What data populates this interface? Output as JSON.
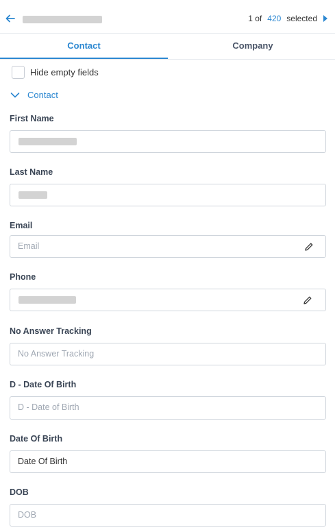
{
  "header": {
    "pager_prefix": "1 of",
    "pager_count": "420",
    "pager_suffix": "selected"
  },
  "tabs": [
    {
      "label": "Contact",
      "active": true
    },
    {
      "label": "Company",
      "active": false
    }
  ],
  "hide_empty_label": "Hide empty fields",
  "section": {
    "label": "Contact",
    "expanded": true
  },
  "fields": {
    "first_name": {
      "label": "First Name"
    },
    "last_name": {
      "label": "Last Name"
    },
    "email": {
      "label": "Email",
      "placeholder": "Email"
    },
    "phone": {
      "label": "Phone"
    },
    "no_answer": {
      "label": "No Answer Tracking",
      "placeholder": "No Answer Tracking"
    },
    "d_dob": {
      "label": "D - Date Of Birth",
      "placeholder": "D - Date of Birth"
    },
    "date_of_birth": {
      "label": "Date Of Birth",
      "value": "Date Of Birth"
    },
    "dob": {
      "label": "DOB",
      "placeholder": "DOB"
    }
  },
  "colors": {
    "accent": "#2b87d1",
    "border": "#cfd5dc",
    "placeholder": "#a0a8b3"
  },
  "icons": [
    "arrow-left-icon",
    "caret-right-icon",
    "chevron-down-icon",
    "pencil-icon"
  ]
}
